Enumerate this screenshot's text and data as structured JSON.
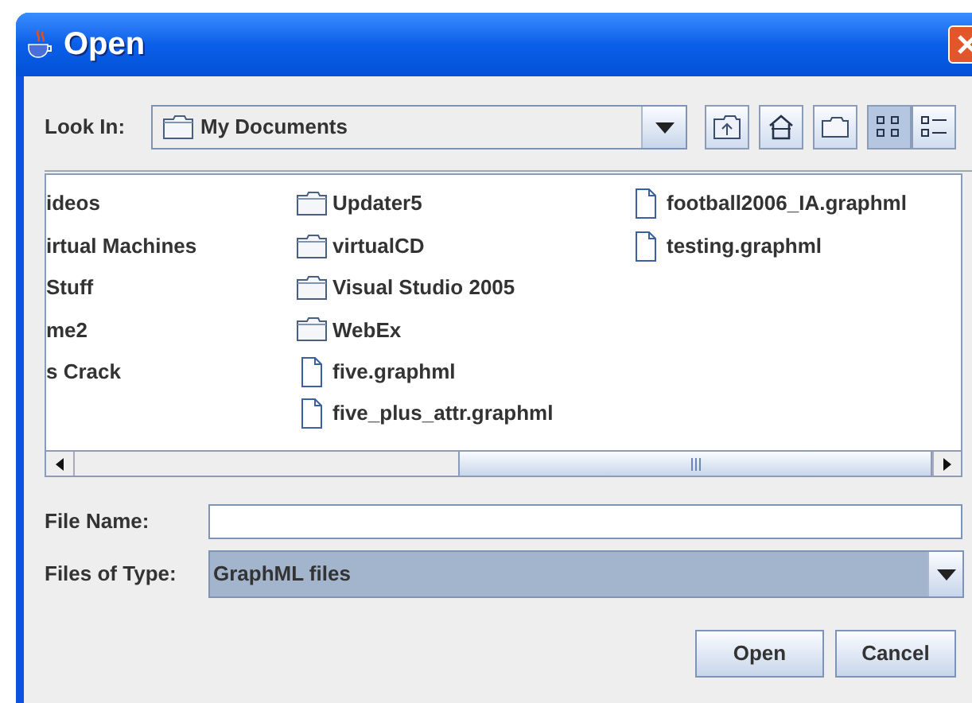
{
  "window": {
    "title": "Open"
  },
  "look_in": {
    "label": "Look In:",
    "value": "My Documents"
  },
  "toolbar": [
    {
      "kind": "up"
    },
    {
      "kind": "home"
    },
    {
      "kind": "new-folder"
    }
  ],
  "view_buttons": [
    {
      "kind": "list",
      "selected": true
    },
    {
      "kind": "details",
      "selected": false
    }
  ],
  "files": {
    "columns": [
      [
        {
          "name": "ideos"
        },
        {
          "name": "irtual Machines"
        },
        {
          "name": "Stuff"
        },
        {
          "name": "me2"
        },
        {
          "name": "s Crack"
        }
      ],
      [
        {
          "name": "Updater5",
          "kind": "folder"
        },
        {
          "name": "virtualCD",
          "kind": "folder"
        },
        {
          "name": "Visual Studio 2005",
          "kind": "folder"
        },
        {
          "name": "WebEx",
          "kind": "folder"
        },
        {
          "name": "five.graphml",
          "kind": "file"
        },
        {
          "name": "five_plus_attr.graphml",
          "kind": "file"
        }
      ],
      [
        {
          "name": "football2006_IA.graphml",
          "kind": "file"
        },
        {
          "name": "testing.graphml",
          "kind": "file"
        }
      ]
    ]
  },
  "file_name": {
    "label": "File Name:"
  },
  "file_type": {
    "label": "Files of Type:",
    "value": "GraphML files"
  },
  "buttons": [
    "Open",
    "Cancel"
  ]
}
